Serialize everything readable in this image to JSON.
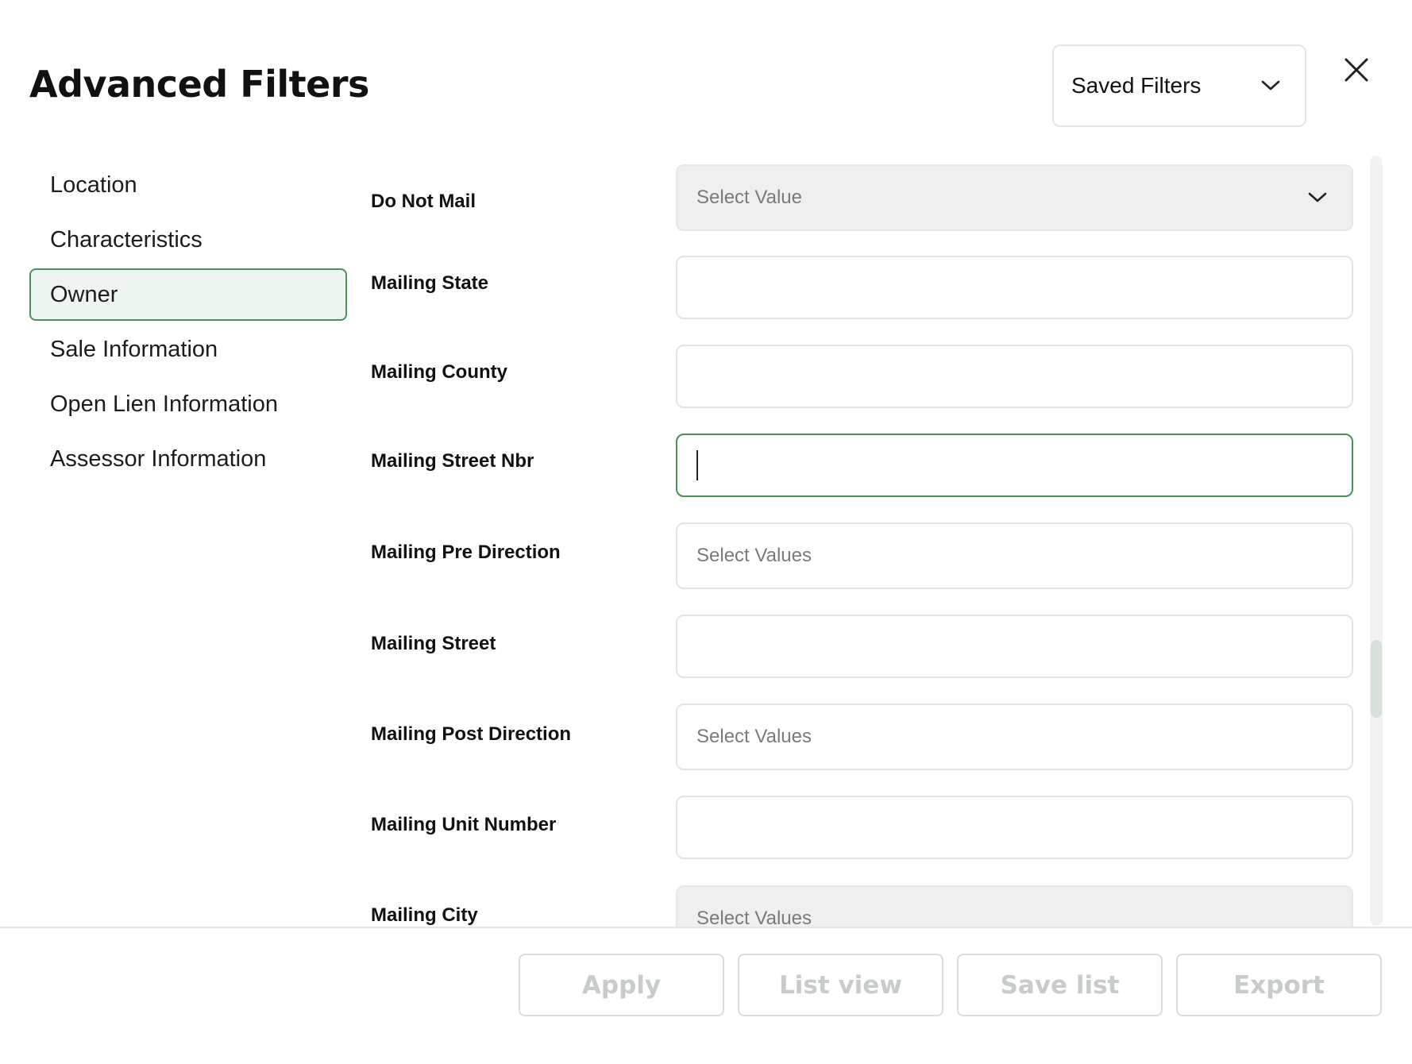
{
  "header": {
    "title": "Advanced Filters",
    "saved_filters_label": "Saved Filters"
  },
  "sidebar": {
    "items": [
      {
        "label": "Location",
        "active": false
      },
      {
        "label": "Characteristics",
        "active": false
      },
      {
        "label": "Owner",
        "active": true
      },
      {
        "label": "Sale Information",
        "active": false
      },
      {
        "label": "Open Lien Information",
        "active": false
      },
      {
        "label": "Assessor Information",
        "active": false
      }
    ]
  },
  "form": {
    "fields": [
      {
        "label": "Do Not Mail",
        "type": "dropdown",
        "placeholder": "Select Value",
        "value": ""
      },
      {
        "label": "Mailing State",
        "type": "text",
        "placeholder": "",
        "value": ""
      },
      {
        "label": "Mailing County",
        "type": "text",
        "placeholder": "",
        "value": ""
      },
      {
        "label": "Mailing Street Nbr",
        "type": "text",
        "placeholder": "",
        "value": "",
        "focused": true
      },
      {
        "label": "Mailing Pre Direction",
        "type": "multiselect",
        "placeholder": "Select Values",
        "value": ""
      },
      {
        "label": "Mailing Street",
        "type": "text",
        "placeholder": "",
        "value": ""
      },
      {
        "label": "Mailing Post Direction",
        "type": "multiselect",
        "placeholder": "Select Values",
        "value": ""
      },
      {
        "label": "Mailing Unit Number",
        "type": "text",
        "placeholder": "",
        "value": ""
      },
      {
        "label": "Mailing City",
        "type": "multiselect",
        "placeholder": "Select Values",
        "value": ""
      }
    ]
  },
  "footer": {
    "apply_label": "Apply",
    "list_view_label": "List view",
    "save_list_label": "Save list",
    "export_label": "Export"
  },
  "colors": {
    "accent": "#4c8f57",
    "active_bg": "#eef4ef",
    "disabled_text": "#c7cbc9"
  }
}
